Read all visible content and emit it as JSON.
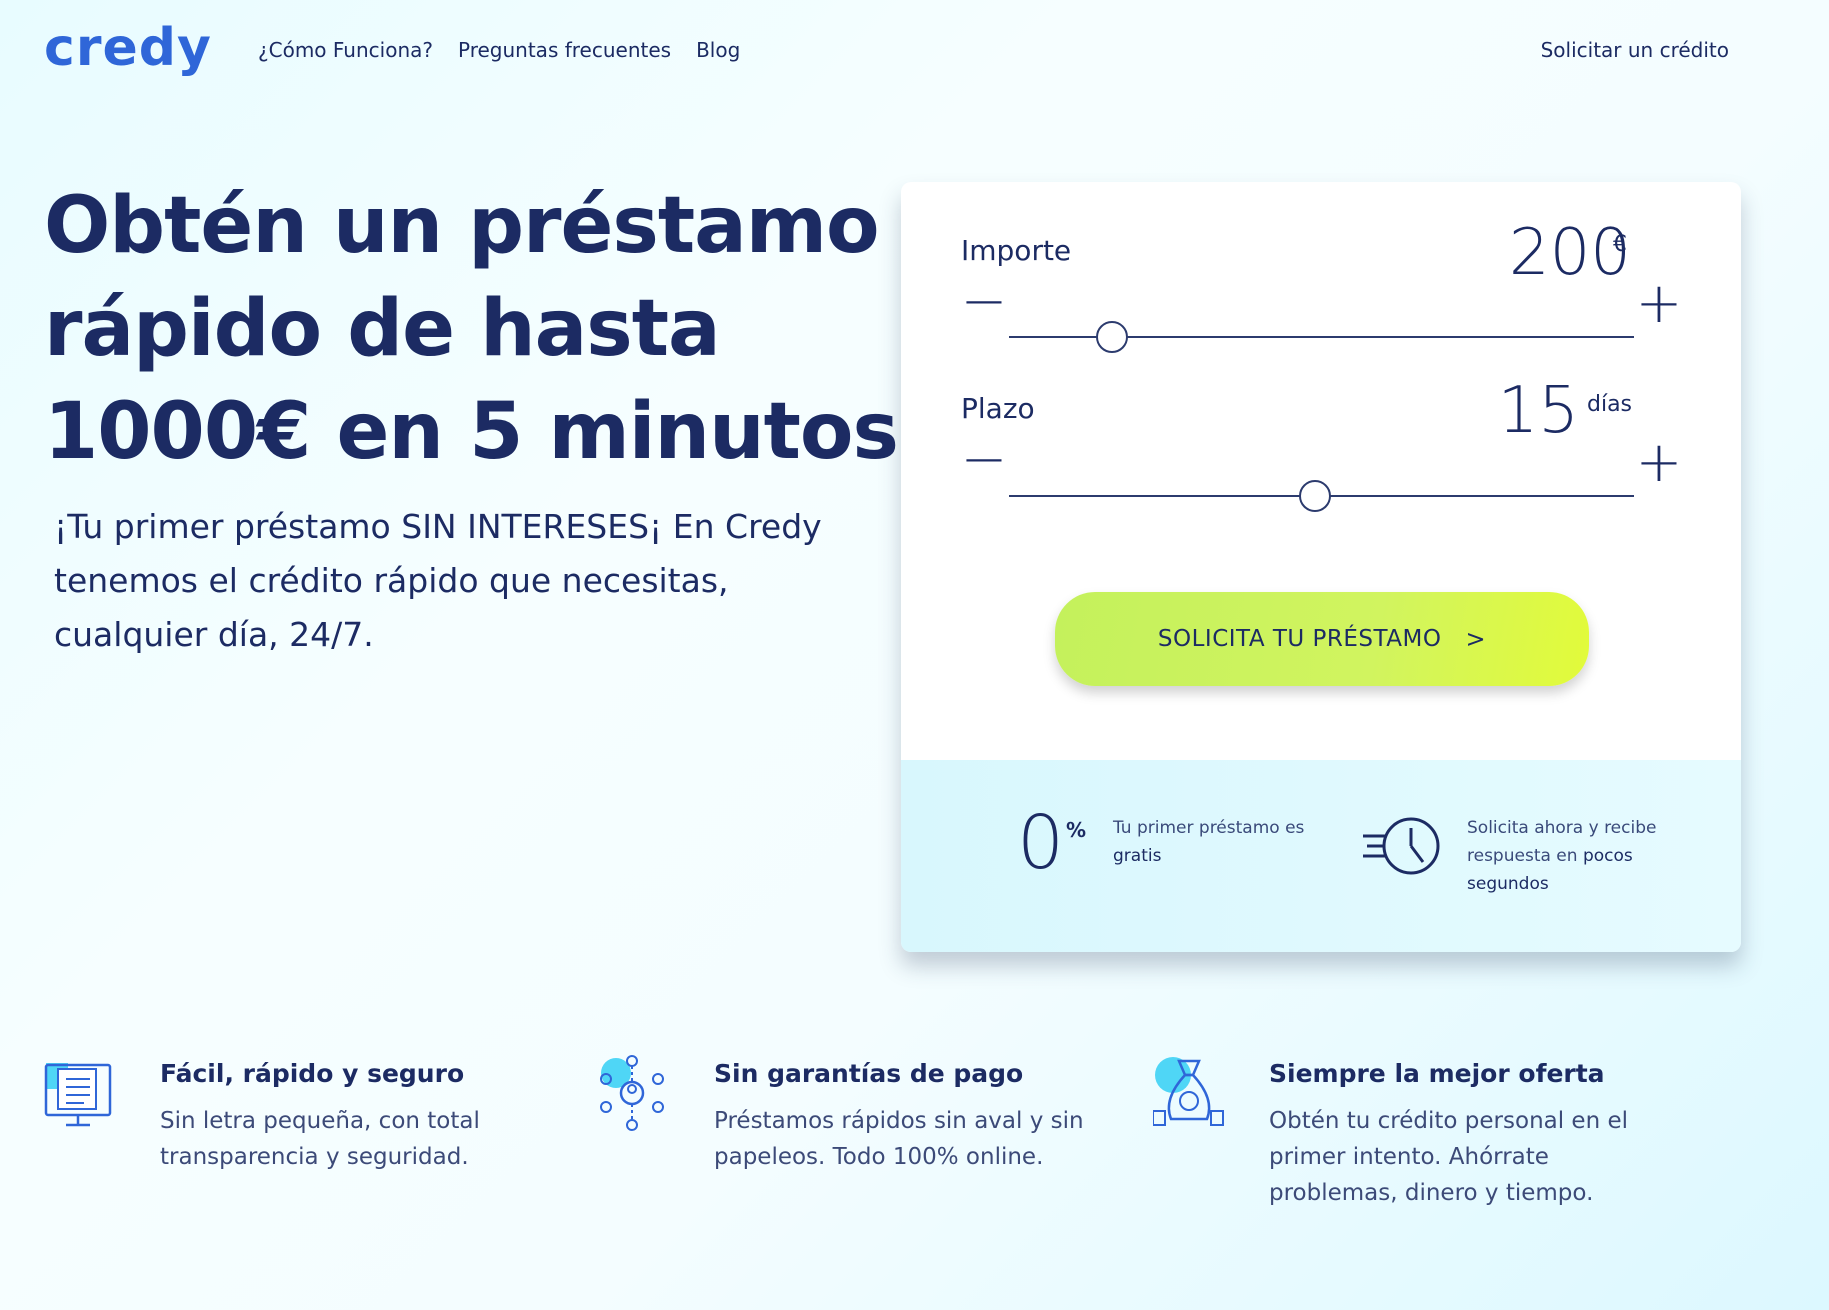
{
  "brand": {
    "logo": "credy",
    "accent": "#2f66d8",
    "text_color": "#1c2b63",
    "cta_color": "#cdf35c"
  },
  "nav": {
    "items": [
      "¿Cómo Funciona?",
      "Preguntas frecuentes",
      "Blog"
    ],
    "right_link": "Solicitar un crédito"
  },
  "hero": {
    "title_lines": [
      "Obtén un préstamo",
      "rápido de hasta",
      "1000€ en 5 minutos"
    ],
    "subtitle": "¡Tu primer préstamo SIN INTERESES¡ En Credy tenemos el crédito rápido que necesitas, cualquier día, 24/7."
  },
  "calculator": {
    "amount": {
      "label": "Importe",
      "value": "200",
      "unit": "€",
      "minus": "−",
      "plus": "+",
      "slider_fraction": 0.165
    },
    "term": {
      "label": "Plazo",
      "value": "15",
      "unit": "días",
      "minus": "−",
      "plus": "+",
      "slider_fraction": 0.49
    },
    "cta_label": "SOLICITA TU PRÉSTAMO",
    "cta_arrow": ">",
    "info": [
      {
        "big": "0",
        "suffix": "%",
        "text": "Tu primer préstamo es",
        "bold": "gratis",
        "icon": "percent-icon"
      },
      {
        "text": "Solicita ahora y recibe respuesta en",
        "bold": "pocos segundos",
        "icon": "fast-clock-icon"
      }
    ]
  },
  "features": [
    {
      "title": "Fácil, rápido y seguro",
      "text": "Sin letra pequeña, con total transparencia y seguridad.",
      "icon": "checklist-monitor-icon"
    },
    {
      "title": "Sin garantías de pago",
      "text": "Préstamos rápidos sin aval y sin papeleos. Todo 100% online.",
      "icon": "network-user-icon"
    },
    {
      "title": "Siempre la mejor oferta",
      "text": "Obtén tu crédito personal en el primer intento. Ahórrate problemas, dinero y tiempo.",
      "icon": "money-bag-icon"
    }
  ]
}
